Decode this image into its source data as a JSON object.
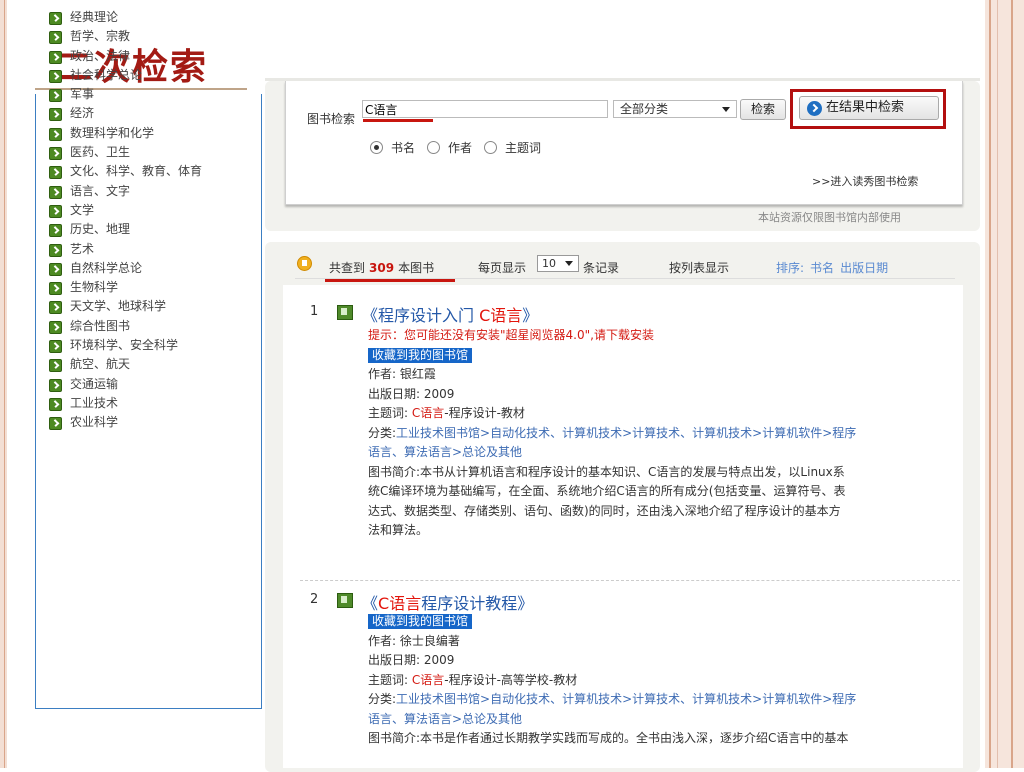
{
  "slide": {
    "title": "二次检索"
  },
  "categories": [
    "经典理论",
    "哲学、宗教",
    "政治、法律",
    "社会科学总论",
    "军事",
    "经济",
    "数理科学和化学",
    "医药、卫生",
    "文化、科学、教育、体育",
    "语言、文字",
    "文学",
    "历史、地理",
    "艺术",
    "自然科学总论",
    "生物科学",
    "天文学、地球科学",
    "综合性图书",
    "环境科学、安全科学",
    "航空、航天",
    "交通运输",
    "工业技术",
    "农业科学"
  ],
  "search": {
    "label": "图书检索",
    "query": "C语言",
    "category": "全部分类",
    "search_button": "检索",
    "refine_button": "在结果中检索",
    "radios": [
      "书名",
      "作者",
      "主题词"
    ],
    "selected_radio": "书名",
    "advanced_link": ">>进入读秀图书检索",
    "notice": "本站资源仅限图书馆内部使用"
  },
  "results_header": {
    "prefix": "共查到",
    "count": "309",
    "suffix": "本图书",
    "per_page_label": "每页显示",
    "per_page": "10",
    "records_label": "条记录",
    "list_view": "按列表显示",
    "sort_label": "排序:",
    "sort_options": [
      "书名",
      "出版日期"
    ]
  },
  "results": [
    {
      "num": "1",
      "title_pre": "《程序设计入门 ",
      "title_hl": "C语言",
      "title_post": "》",
      "tip": "提示：您可能还没有安装\"超星阅览器4.0\",请下载安装",
      "fav": "收藏到我的图书馆",
      "author": "作者: 银红霞",
      "date": "出版日期: 2009",
      "subject_label": "主题词: ",
      "subject_hl": "C语言",
      "subject_rest": "-程序设计-教材",
      "class_label": "分类:",
      "class_line1": "工业技术图书馆>自动化技术、计算机技术>计算技术、计算机技术>计算机软件>程序",
      "class_line2": "语言、算法语言>总论及其他",
      "summary": [
        "图书简介:本书从计算机语言和程序设计的基本知识、C语言的发展与特点出发，以Linux系",
        "统C编译环境为基础编写，在全面、系统地介绍C语言的所有成分(包括变量、运算符号、表",
        "达式、数据类型、存储类别、语句、函数)的同时，还由浅入深地介绍了程序设计的基本方",
        "法和算法。"
      ]
    },
    {
      "num": "2",
      "title_pre": "《",
      "title_hl": "C语言",
      "title_post": "程序设计教程》",
      "fav": "收藏到我的图书馆",
      "author": "作者: 徐士良编著",
      "date": "出版日期: 2009",
      "subject_label": "主题词: ",
      "subject_hl": "C语言",
      "subject_rest": "-程序设计-高等学校-教材",
      "class_label": "分类:",
      "class_line1": "工业技术图书馆>自动化技术、计算机技术>计算技术、计算机技术>计算机软件>程序",
      "class_line2": "语言、算法语言>总论及其他",
      "summary": [
        "图书简介:本书是作者通过长期教学实践而写成的。全书由浅入深，逐步介绍C语言中的基本"
      ]
    }
  ]
}
